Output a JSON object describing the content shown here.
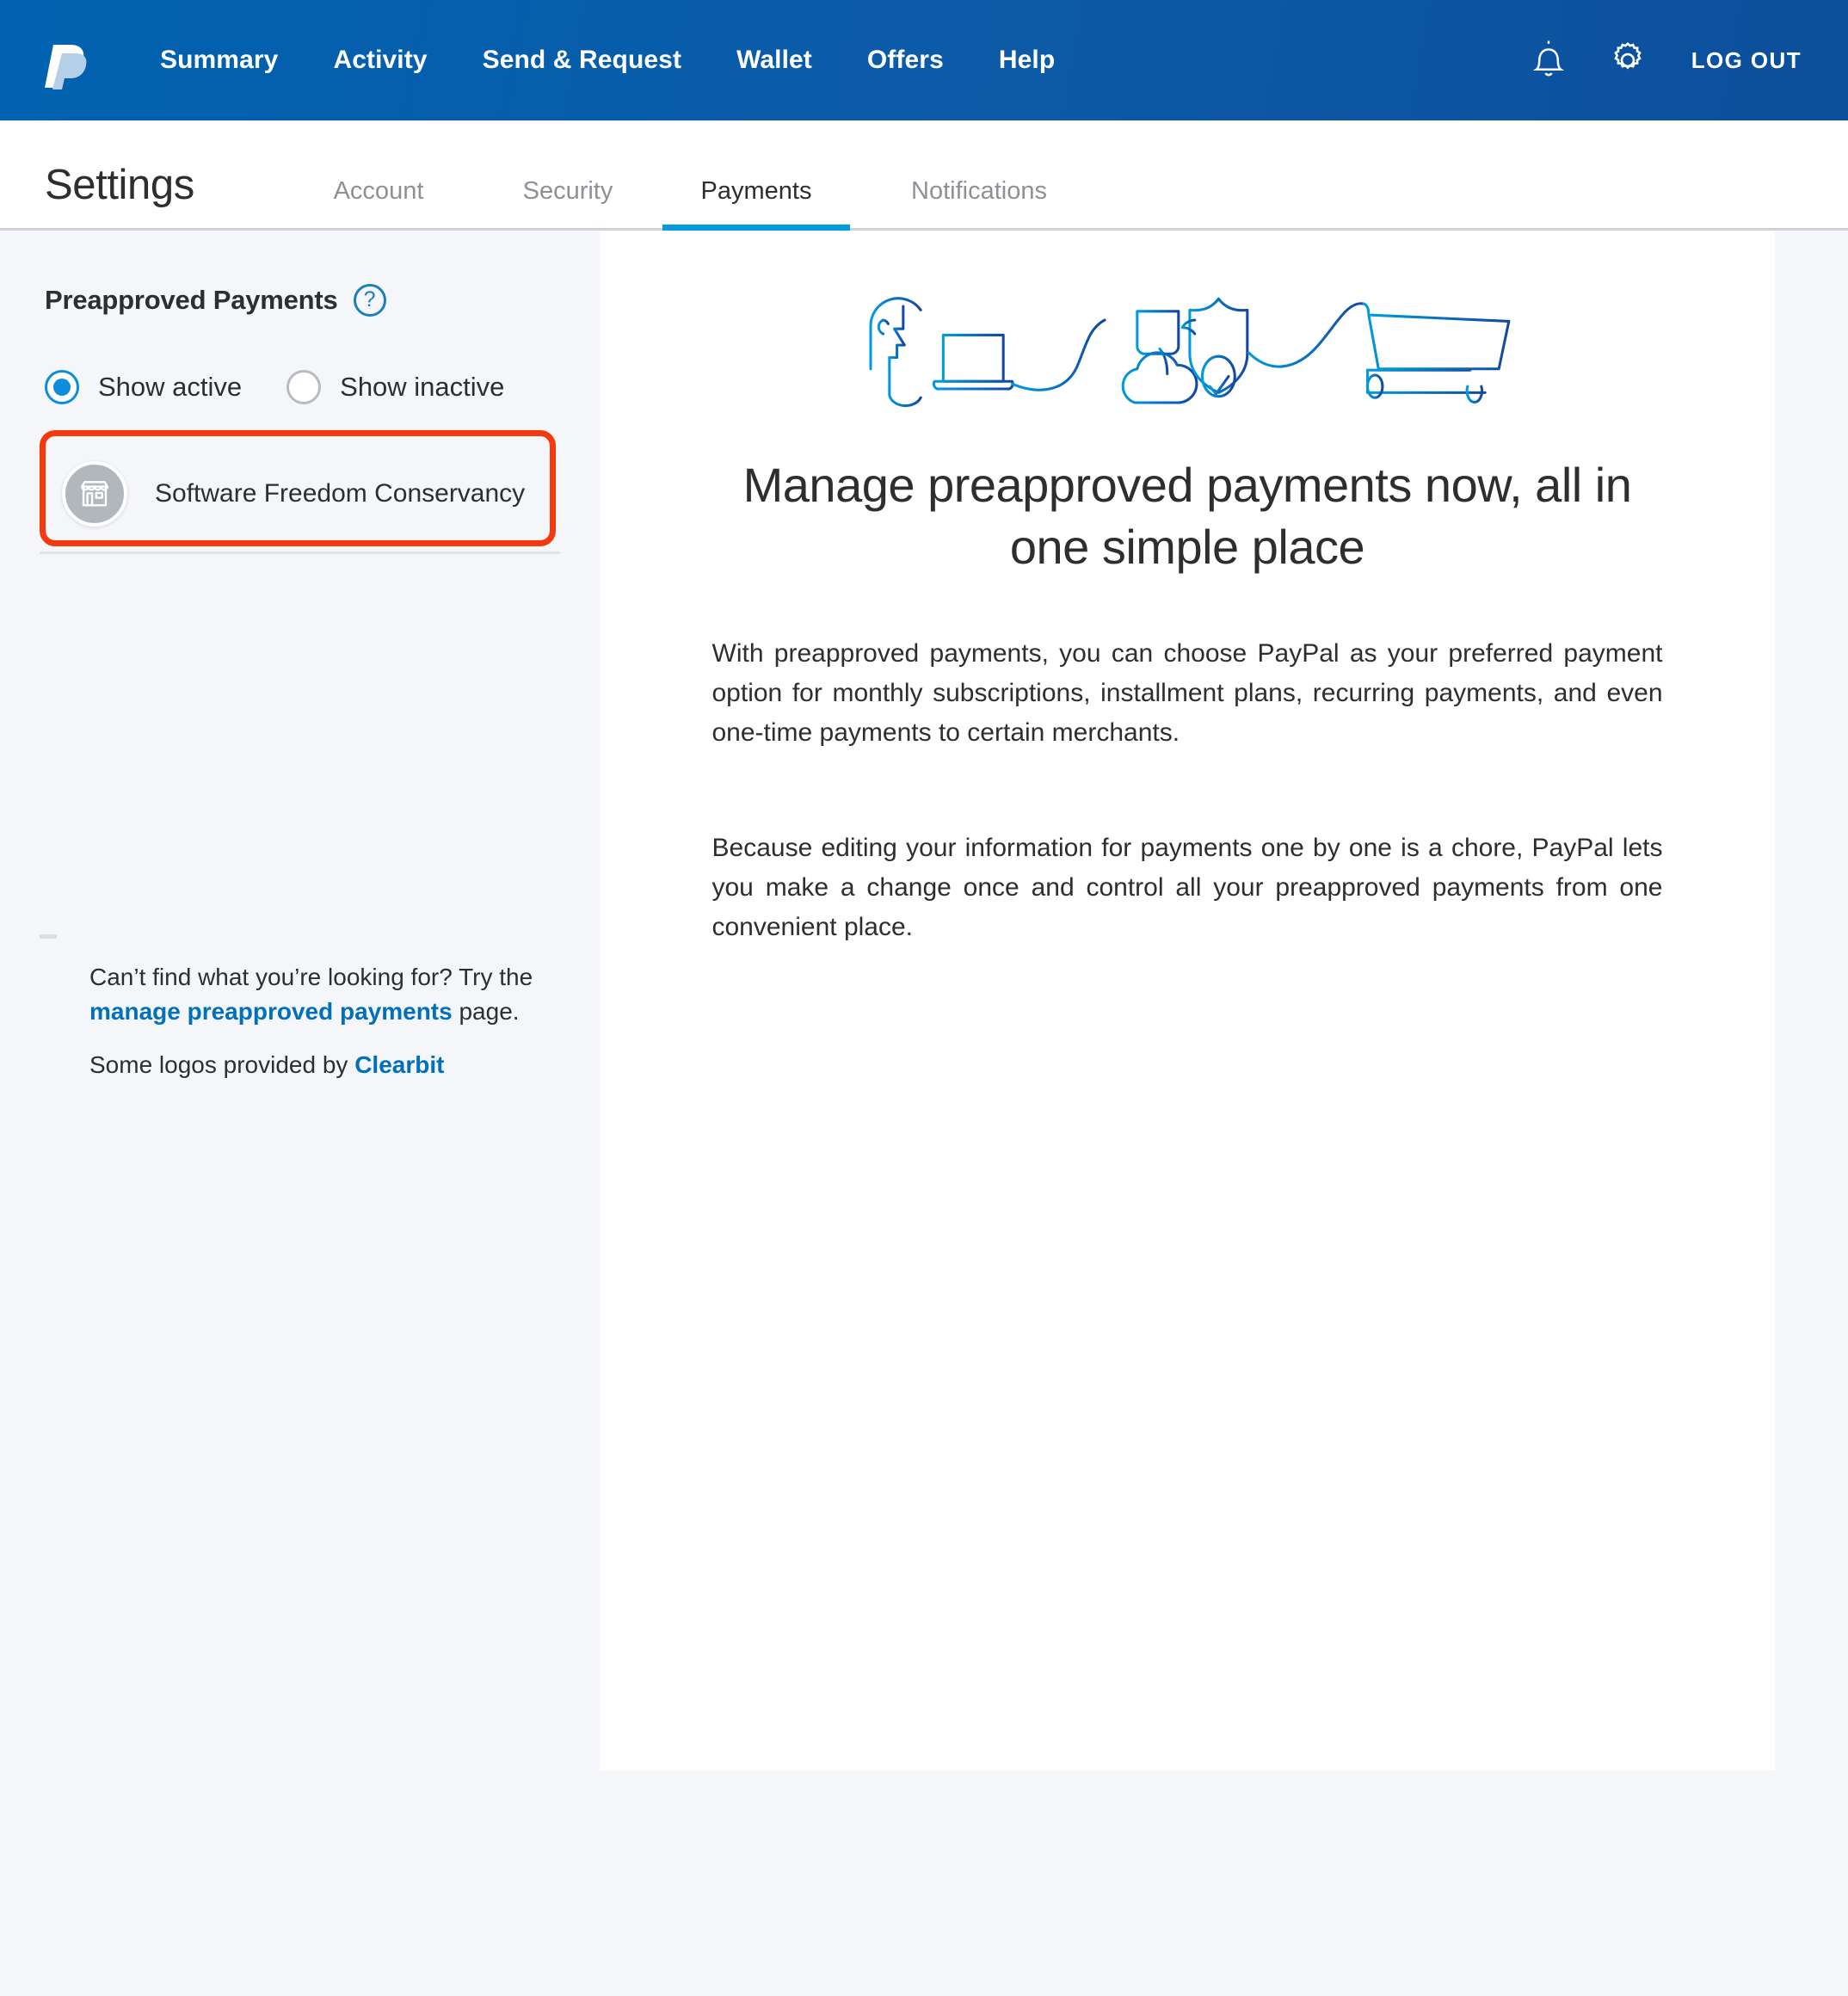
{
  "topbar": {
    "logo_name": "paypal-logo",
    "nav": [
      {
        "label": "Summary"
      },
      {
        "label": "Activity"
      },
      {
        "label": "Send & Request"
      },
      {
        "label": "Wallet"
      },
      {
        "label": "Offers"
      },
      {
        "label": "Help"
      }
    ],
    "bell_icon": "bell-icon",
    "gear_icon": "gear-icon",
    "logout_label": "LOG OUT",
    "bg_color": "#0d5aa7"
  },
  "subheader": {
    "title": "Settings",
    "tabs": [
      {
        "label": "Account",
        "active": false
      },
      {
        "label": "Security",
        "active": false
      },
      {
        "label": "Payments",
        "active": true
      },
      {
        "label": "Notifications",
        "active": false
      }
    ],
    "active_underline_color": "#009cde"
  },
  "sidebar": {
    "heading": "Preapproved Payments",
    "help_icon": "question-mark-icon",
    "help_glyph": "?",
    "filters": [
      {
        "label": "Show active",
        "selected": true
      },
      {
        "label": "Show inactive",
        "selected": false
      }
    ],
    "merchants": [
      {
        "name": "Software Freedom Conservancy",
        "icon": "storefront-icon",
        "highlighted": true
      }
    ],
    "highlight_color": "#f5390f",
    "footer": {
      "line1_before": "Can’t find what you’re looking for? Try the ",
      "line1_link": "manage preapproved payments",
      "line1_after": " page.",
      "line2_before": "Some logos provided by ",
      "line2_link": "Clearbit",
      "link_color": "#0070ba"
    }
  },
  "main": {
    "illustration_name": "preapproved-payments-illustration",
    "heading": "Manage preapproved payments now, all in one simple place",
    "paragraph1": "With preapproved payments, you can choose PayPal as your preferred payment option for monthly subscriptions, installment plans, recurring payments, and even one-time payments to certain merchants.",
    "paragraph2": "Because editing your information for payments one by one is a chore, PayPal lets you make a change once and control all your preapproved payments from one convenient place."
  }
}
